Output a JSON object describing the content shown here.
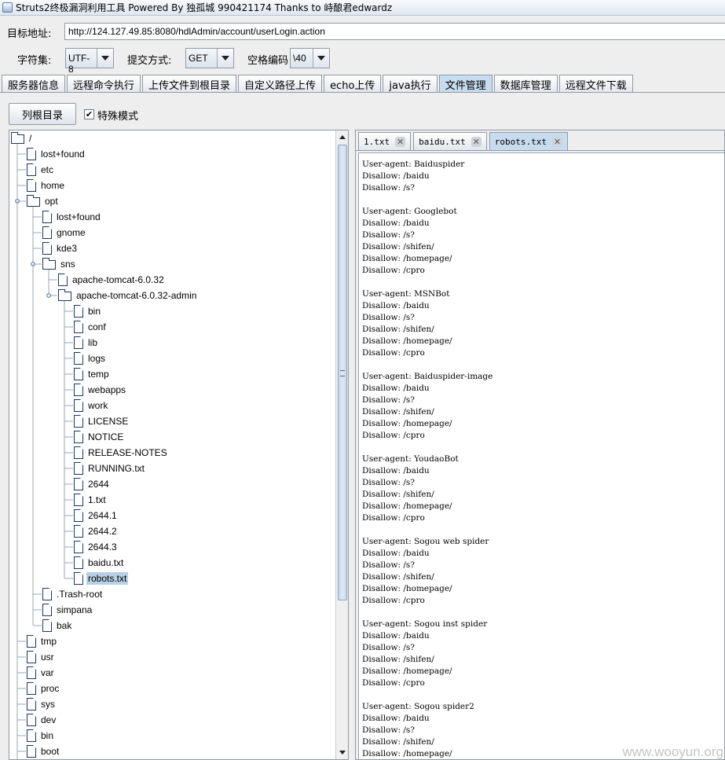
{
  "window": {
    "title": "Struts2终极漏洞利用工具   Powered By 独孤城 990421174 Thanks to 峙酿君edwardz"
  },
  "target": {
    "label": "目标地址:",
    "url": "http://124.127.49.85:8080/hdlAdmin/account/userLogin.action"
  },
  "options": {
    "charset_label": "字符集:",
    "charset_value": "UTF-8",
    "method_label": "提交方式:",
    "method_value": "GET",
    "space_label": "空格编码",
    "space_value": "\\40"
  },
  "main_tabs": [
    {
      "label": "服务器信息",
      "active": false
    },
    {
      "label": "远程命令执行",
      "active": false
    },
    {
      "label": "上传文件到根目录",
      "active": false
    },
    {
      "label": "自定义路径上传",
      "active": false
    },
    {
      "label": "echo上传",
      "active": false
    },
    {
      "label": "java执行",
      "active": false
    },
    {
      "label": "文件管理",
      "active": true
    },
    {
      "label": "数据库管理",
      "active": false
    },
    {
      "label": "远程文件下载",
      "active": false
    }
  ],
  "toolbar": {
    "list_root_label": "列根目录",
    "special_mode_checked": "✔",
    "special_mode_label": "特殊模式"
  },
  "tree": [
    {
      "name": "/",
      "depth": 0,
      "type": "folder",
      "expanded": true
    },
    {
      "name": "lost+found",
      "depth": 1,
      "type": "file"
    },
    {
      "name": "etc",
      "depth": 1,
      "type": "file"
    },
    {
      "name": "home",
      "depth": 1,
      "type": "file"
    },
    {
      "name": "opt",
      "depth": 1,
      "type": "folder",
      "expanded": true
    },
    {
      "name": "lost+found",
      "depth": 2,
      "type": "file"
    },
    {
      "name": "gnome",
      "depth": 2,
      "type": "file"
    },
    {
      "name": "kde3",
      "depth": 2,
      "type": "file"
    },
    {
      "name": "sns",
      "depth": 2,
      "type": "folder",
      "expanded": true
    },
    {
      "name": "apache-tomcat-6.0.32",
      "depth": 3,
      "type": "file"
    },
    {
      "name": "apache-tomcat-6.0.32-admin",
      "depth": 3,
      "type": "folder",
      "expanded": true
    },
    {
      "name": "bin",
      "depth": 4,
      "type": "file"
    },
    {
      "name": "conf",
      "depth": 4,
      "type": "file"
    },
    {
      "name": "lib",
      "depth": 4,
      "type": "file"
    },
    {
      "name": "logs",
      "depth": 4,
      "type": "file"
    },
    {
      "name": "temp",
      "depth": 4,
      "type": "file"
    },
    {
      "name": "webapps",
      "depth": 4,
      "type": "file"
    },
    {
      "name": "work",
      "depth": 4,
      "type": "file"
    },
    {
      "name": "LICENSE",
      "depth": 4,
      "type": "file"
    },
    {
      "name": "NOTICE",
      "depth": 4,
      "type": "file"
    },
    {
      "name": "RELEASE-NOTES",
      "depth": 4,
      "type": "file"
    },
    {
      "name": "RUNNING.txt",
      "depth": 4,
      "type": "file"
    },
    {
      "name": "2644",
      "depth": 4,
      "type": "file"
    },
    {
      "name": "1.txt",
      "depth": 4,
      "type": "file"
    },
    {
      "name": "2644.1",
      "depth": 4,
      "type": "file"
    },
    {
      "name": "2644.2",
      "depth": 4,
      "type": "file"
    },
    {
      "name": "2644.3",
      "depth": 4,
      "type": "file"
    },
    {
      "name": "baidu.txt",
      "depth": 4,
      "type": "file"
    },
    {
      "name": "robots.txt",
      "depth": 4,
      "type": "file",
      "selected": true
    },
    {
      "name": ".Trash-root",
      "depth": 2,
      "type": "file"
    },
    {
      "name": "simpana",
      "depth": 2,
      "type": "file"
    },
    {
      "name": "bak",
      "depth": 2,
      "type": "file"
    },
    {
      "name": "tmp",
      "depth": 1,
      "type": "file"
    },
    {
      "name": "usr",
      "depth": 1,
      "type": "file"
    },
    {
      "name": "var",
      "depth": 1,
      "type": "file"
    },
    {
      "name": "proc",
      "depth": 1,
      "type": "file"
    },
    {
      "name": "sys",
      "depth": 1,
      "type": "file"
    },
    {
      "name": "dev",
      "depth": 1,
      "type": "file"
    },
    {
      "name": "bin",
      "depth": 1,
      "type": "file"
    },
    {
      "name": "boot",
      "depth": 1,
      "type": "file"
    },
    {
      "name": "...",
      "depth": 1,
      "type": "file"
    }
  ],
  "file_tabs": [
    {
      "label": "1.txt",
      "active": false
    },
    {
      "label": "baidu.txt",
      "active": false
    },
    {
      "label": "robots.txt",
      "active": true
    }
  ],
  "file_content": [
    "User-agent: Baiduspider",
    "Disallow: /baidu",
    "Disallow: /s?",
    "",
    "User-agent: Googlebot",
    "Disallow: /baidu",
    "Disallow: /s?",
    "Disallow: /shifen/",
    "Disallow: /homepage/",
    "Disallow: /cpro",
    "",
    "User-agent: MSNBot",
    "Disallow: /baidu",
    "Disallow: /s?",
    "Disallow: /shifen/",
    "Disallow: /homepage/",
    "Disallow: /cpro",
    "",
    "User-agent: Baiduspider-image",
    "Disallow: /baidu",
    "Disallow: /s?",
    "Disallow: /shifen/",
    "Disallow: /homepage/",
    "Disallow: /cpro",
    "",
    "User-agent: YoudaoBot",
    "Disallow: /baidu",
    "Disallow: /s?",
    "Disallow: /shifen/",
    "Disallow: /homepage/",
    "Disallow: /cpro",
    "",
    "User-agent: Sogou web spider",
    "Disallow: /baidu",
    "Disallow: /s?",
    "Disallow: /shifen/",
    "Disallow: /homepage/",
    "Disallow: /cpro",
    "",
    "User-agent: Sogou inst spider",
    "Disallow: /baidu",
    "Disallow: /s?",
    "Disallow: /shifen/",
    "Disallow: /homepage/",
    "Disallow: /cpro",
    "",
    "User-agent: Sogou spider2",
    "Disallow: /baidu",
    "Disallow: /s?",
    "Disallow: /shifen/",
    "Disallow: /homepage/"
  ],
  "watermark": "www.wooyun.org",
  "icons": {
    "tab_close": "close-icon",
    "tree_file": "file-icon",
    "tree_folder": "folder-icon"
  }
}
